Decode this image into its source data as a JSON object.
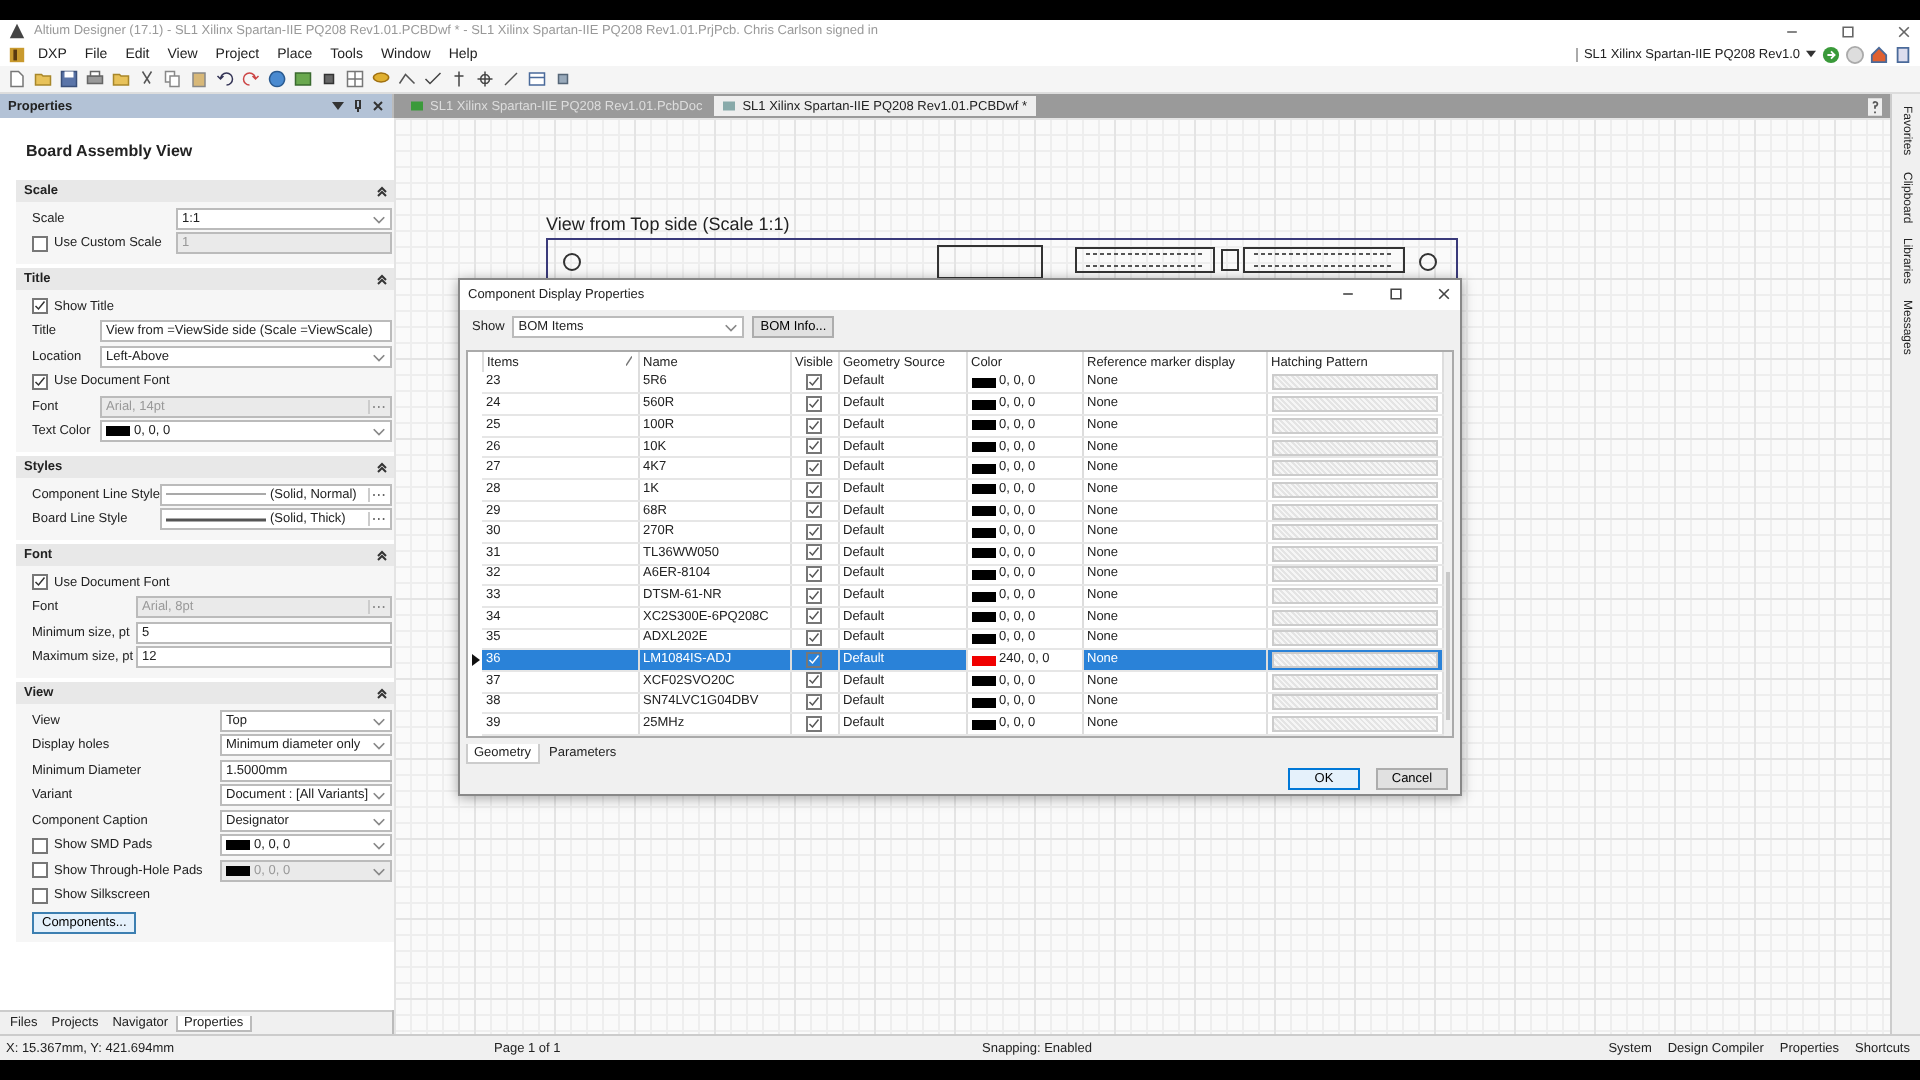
{
  "window": {
    "title": "Altium Designer (17.1) - SL1 Xilinx Spartan-IIE PQ208 Rev1.01.PCBDwf * - SL1 Xilinx Spartan-IIE PQ208 Rev1.01.PrjPcb. Chris Carlson signed in"
  },
  "menu": [
    "DXP",
    "File",
    "Edit",
    "View",
    "Project",
    "Place",
    "Tools",
    "Window",
    "Help"
  ],
  "project_selector": {
    "value": "SL1 Xilinx Spartan-IIE PQ208 Rev1.0"
  },
  "properties_panel": {
    "title": "Properties",
    "heading": "Board Assembly View",
    "sections": [
      {
        "title": "Scale",
        "expanded": true,
        "rows": [
          {
            "kind": "select",
            "label": "Scale",
            "value": "1:1",
            "disabled": false
          },
          {
            "kind": "check_input",
            "label": "Use Custom Scale",
            "checked": false,
            "value": "1",
            "disabled": true
          }
        ]
      },
      {
        "title": "Title",
        "expanded": true,
        "rows": [
          {
            "kind": "check",
            "label": "Show Title",
            "checked": true
          },
          {
            "kind": "input",
            "label": "Title",
            "value": "View from =ViewSide side (Scale =ViewScale)",
            "disabled": false
          },
          {
            "kind": "select",
            "label": "Location",
            "value": "Left-Above",
            "disabled": false
          },
          {
            "kind": "check",
            "label": "Use Document Font",
            "checked": true
          },
          {
            "kind": "font",
            "label": "Font",
            "value": "Arial, 14pt",
            "disabled": true
          },
          {
            "kind": "color",
            "label": "Text Color",
            "value": "0, 0, 0",
            "color": "#000000",
            "disabled": false
          }
        ]
      },
      {
        "title": "Styles",
        "expanded": true,
        "rows": [
          {
            "kind": "line",
            "label": "Component Line Style",
            "value": "(Solid, Normal)",
            "thick": false
          },
          {
            "kind": "line",
            "label": "Board Line Style",
            "value": "(Solid, Thick)",
            "thick": true
          }
        ]
      },
      {
        "title": "Font",
        "expanded": true,
        "rows": [
          {
            "kind": "check",
            "label": "Use Document Font",
            "checked": true
          },
          {
            "kind": "font",
            "label": "Font",
            "value": "Arial, 8pt",
            "disabled": true
          },
          {
            "kind": "input",
            "label": "Minimum size, pt",
            "value": "5",
            "disabled": false
          },
          {
            "kind": "input",
            "label": "Maximum size, pt",
            "value": "12",
            "disabled": false
          }
        ]
      },
      {
        "title": "View",
        "expanded": true,
        "rows": [
          {
            "kind": "select",
            "label": "View",
            "value": "Top",
            "disabled": false
          },
          {
            "kind": "select",
            "label": "Display holes",
            "value": "Minimum diameter only",
            "disabled": false
          },
          {
            "kind": "input",
            "label": "Minimum Diameter",
            "value": "1.5000mm",
            "disabled": false
          },
          {
            "kind": "select",
            "label": "Variant",
            "value": "Document : [All Variants]",
            "disabled": false
          },
          {
            "kind": "select",
            "label": "Component Caption",
            "value": "Designator",
            "disabled": false
          },
          {
            "kind": "check_color",
            "label": "Show SMD Pads",
            "checked": false,
            "value": "0, 0, 0",
            "color": "#000000",
            "disabled": false
          },
          {
            "kind": "check_color",
            "label": "Show Through-Hole Pads",
            "checked": false,
            "value": "0, 0, 0",
            "color": "#000000",
            "disabled": true
          },
          {
            "kind": "check",
            "label": "Show Silkscreen",
            "checked": false
          },
          {
            "kind": "button",
            "label": "Components..."
          }
        ]
      }
    ],
    "tabs": [
      {
        "label": "Files",
        "selected": false
      },
      {
        "label": "Projects",
        "selected": false
      },
      {
        "label": "Navigator",
        "selected": false
      },
      {
        "label": "Properties",
        "selected": true
      }
    ]
  },
  "document_tabs": [
    {
      "label": "SL1 Xilinx Spartan-IIE PQ208 Rev1.01.PcbDoc",
      "selected": false
    },
    {
      "label": "SL1 Xilinx Spartan-IIE PQ208 Rev1.01.PCBDwf *",
      "selected": true
    }
  ],
  "canvas": {
    "view_title": "View from Top side (Scale 1:1)"
  },
  "side_tabs": [
    "Favorites",
    "Clipboard",
    "Libraries",
    "Messages"
  ],
  "dialog": {
    "title": "Component Display Properties",
    "show_label": "Show",
    "show_value": "BOM Items",
    "info_button": "BOM Info...",
    "columns": [
      "Items",
      "Name",
      "Visible",
      "Geometry Source",
      "Color",
      "Reference marker display",
      "Hatching Pattern"
    ],
    "rows": [
      {
        "item": "23",
        "name": "5R6",
        "visible": true,
        "source": "Default",
        "color": "#000000",
        "color_text": "0, 0, 0",
        "marker": "None",
        "selected": false
      },
      {
        "item": "24",
        "name": "560R",
        "visible": true,
        "source": "Default",
        "color": "#000000",
        "color_text": "0, 0, 0",
        "marker": "None",
        "selected": false
      },
      {
        "item": "25",
        "name": "100R",
        "visible": true,
        "source": "Default",
        "color": "#000000",
        "color_text": "0, 0, 0",
        "marker": "None",
        "selected": false
      },
      {
        "item": "26",
        "name": "10K",
        "visible": true,
        "source": "Default",
        "color": "#000000",
        "color_text": "0, 0, 0",
        "marker": "None",
        "selected": false
      },
      {
        "item": "27",
        "name": "4K7",
        "visible": true,
        "source": "Default",
        "color": "#000000",
        "color_text": "0, 0, 0",
        "marker": "None",
        "selected": false
      },
      {
        "item": "28",
        "name": "1K",
        "visible": true,
        "source": "Default",
        "color": "#000000",
        "color_text": "0, 0, 0",
        "marker": "None",
        "selected": false
      },
      {
        "item": "29",
        "name": "68R",
        "visible": true,
        "source": "Default",
        "color": "#000000",
        "color_text": "0, 0, 0",
        "marker": "None",
        "selected": false
      },
      {
        "item": "30",
        "name": "270R",
        "visible": true,
        "source": "Default",
        "color": "#000000",
        "color_text": "0, 0, 0",
        "marker": "None",
        "selected": false
      },
      {
        "item": "31",
        "name": "TL36WW050",
        "visible": true,
        "source": "Default",
        "color": "#000000",
        "color_text": "0, 0, 0",
        "marker": "None",
        "selected": false
      },
      {
        "item": "32",
        "name": "A6ER-8104",
        "visible": true,
        "source": "Default",
        "color": "#000000",
        "color_text": "0, 0, 0",
        "marker": "None",
        "selected": false
      },
      {
        "item": "33",
        "name": "DTSM-61-NR",
        "visible": true,
        "source": "Default",
        "color": "#000000",
        "color_text": "0, 0, 0",
        "marker": "None",
        "selected": false
      },
      {
        "item": "34",
        "name": "XC2S300E-6PQ208C",
        "visible": true,
        "source": "Default",
        "color": "#000000",
        "color_text": "0, 0, 0",
        "marker": "None",
        "selected": false
      },
      {
        "item": "35",
        "name": "ADXL202E",
        "visible": true,
        "source": "Default",
        "color": "#000000",
        "color_text": "0, 0, 0",
        "marker": "None",
        "selected": false
      },
      {
        "item": "36",
        "name": "LM1084IS-ADJ",
        "visible": true,
        "source": "Default",
        "color": "#f00000",
        "color_text": "240, 0, 0",
        "marker": "None",
        "selected": true
      },
      {
        "item": "37",
        "name": "XCF02SVO20C",
        "visible": true,
        "source": "Default",
        "color": "#000000",
        "color_text": "0, 0, 0",
        "marker": "None",
        "selected": false
      },
      {
        "item": "38",
        "name": "SN74LVC1G04DBV",
        "visible": true,
        "source": "Default",
        "color": "#000000",
        "color_text": "0, 0, 0",
        "marker": "None",
        "selected": false
      },
      {
        "item": "39",
        "name": "25MHz",
        "visible": true,
        "source": "Default",
        "color": "#000000",
        "color_text": "0, 0, 0",
        "marker": "None",
        "selected": false
      }
    ],
    "tabs": [
      {
        "label": "Geometry",
        "selected": true
      },
      {
        "label": "Parameters",
        "selected": false
      }
    ],
    "buttons": [
      {
        "label": "OK",
        "kind": "default"
      },
      {
        "label": "Cancel",
        "kind": "normal"
      }
    ]
  },
  "status_bar": {
    "coordinates": "X: 15.367mm, Y: 421.694mm",
    "page": "Page 1 of 1",
    "snapping": "Snapping: Enabled",
    "panels": [
      "System",
      "Design Compiler",
      "Properties",
      "Shortcuts"
    ]
  }
}
